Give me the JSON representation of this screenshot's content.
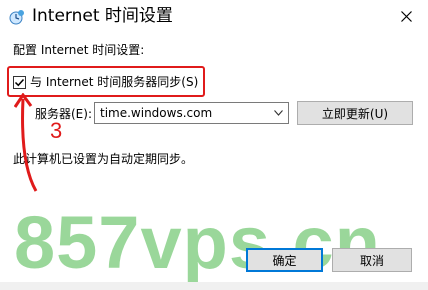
{
  "window": {
    "title": "Internet 时间设置"
  },
  "settings": {
    "section_label": "配置 Internet 时间设置:",
    "sync_checkbox": {
      "label": "与 Internet 时间服务器同步(S)",
      "checked": true
    },
    "server_label": "服务器(E):",
    "server_value": "time.windows.com",
    "update_button": "立即更新(U)",
    "status_text": "此计算机已设置为自动定期同步。"
  },
  "annotation": {
    "number": "3",
    "color": "#e01b1b"
  },
  "watermark": {
    "text": "857vps.cn",
    "color": "#22a822"
  },
  "footer": {
    "ok_button": "确定",
    "cancel_button": "取消"
  },
  "icons": {
    "title": "internet-time-icon",
    "close": "close-icon",
    "check": "check-icon",
    "dropdown": "chevron-down-icon"
  }
}
